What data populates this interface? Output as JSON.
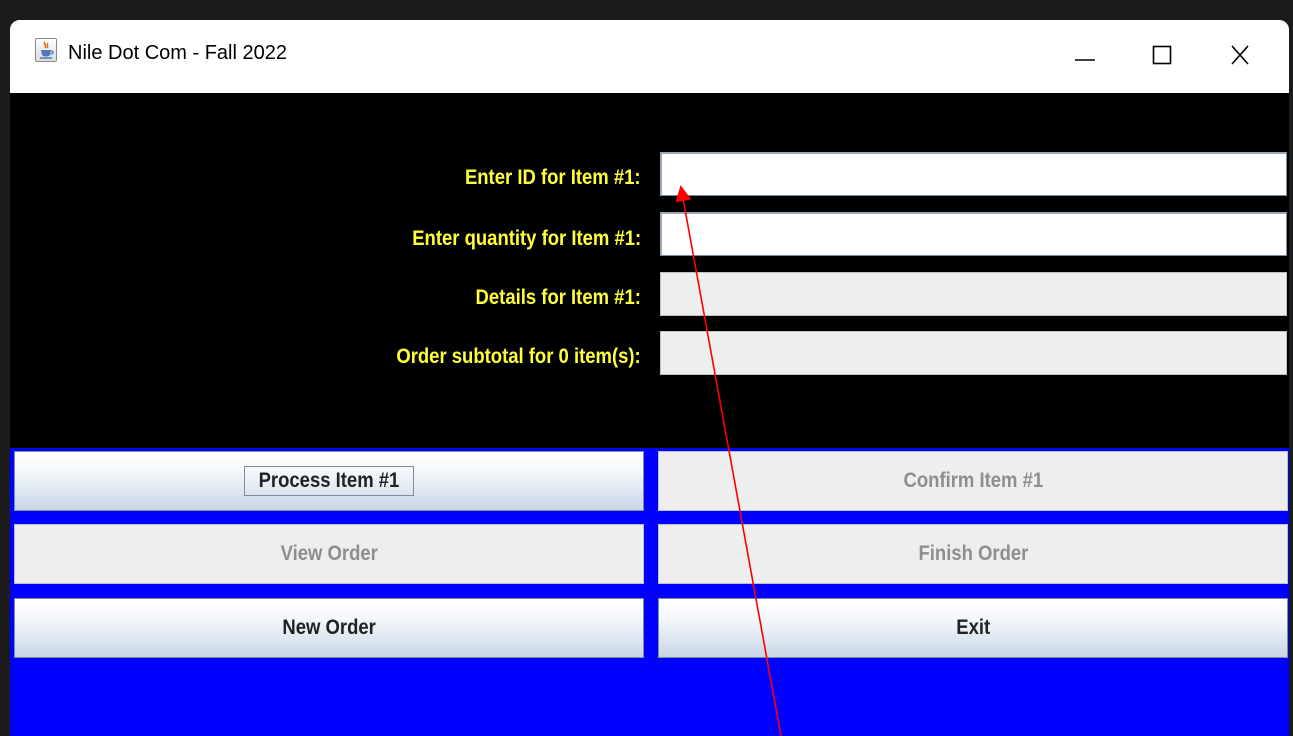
{
  "window": {
    "title": "Nile Dot Com - Fall 2022",
    "app_icon": "java-coffee-cup-icon",
    "controls": {
      "minimize_glyph": "minimize-icon",
      "maximize_glyph": "maximize-icon",
      "close_glyph": "close-icon"
    }
  },
  "form": {
    "item_id_label": "Enter ID for Item #1:",
    "item_id_value": "",
    "quantity_label": "Enter quantity for Item #1:",
    "quantity_value": "",
    "details_label": "Details for Item #1:",
    "details_value": "",
    "subtotal_label": "Order subtotal for 0 item(s):",
    "subtotal_value": ""
  },
  "buttons": {
    "process_item": "Process Item #1",
    "confirm_item": "Confirm Item #1",
    "view_order": "View Order",
    "finish_order": "Finish Order",
    "new_order": "New Order",
    "exit": "Exit"
  },
  "colors": {
    "panel_background": "#000000",
    "label_text": "#ffff3a",
    "button_panel_background": "#0000ff",
    "annotation_arrow": "#ff0000"
  }
}
